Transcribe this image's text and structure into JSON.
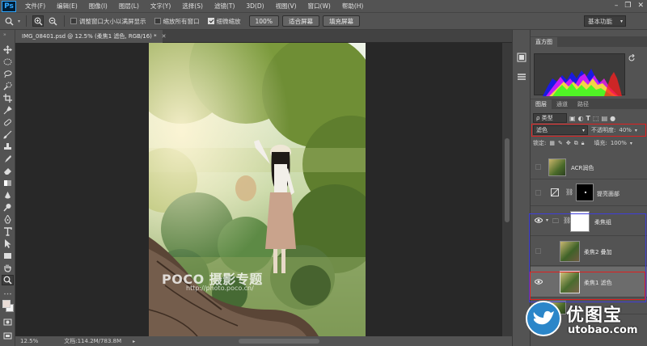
{
  "app": {
    "logo": "Ps"
  },
  "menu": [
    "文件(F)",
    "编辑(E)",
    "图像(I)",
    "图层(L)",
    "文字(Y)",
    "选择(S)",
    "滤镜(T)",
    "3D(D)",
    "视图(V)",
    "窗口(W)",
    "帮助(H)"
  ],
  "options": {
    "check1": "调整窗口大小以满屏显示",
    "check2": "缩放所有窗口",
    "check3": "细微缩放",
    "zoom_btn": "100%",
    "fit_btn": "适合屏幕",
    "fill_btn": "填充屏幕",
    "workspace": "基本功能"
  },
  "document": {
    "tab_title": "IMG_08401.psd @ 12.5% (柔焦1  滤色, RGB/16) *",
    "zoom": "12.5%",
    "doc_size": "文档:114.2M/783.8M",
    "watermark": "POCO 摄影专题",
    "watermark_url": "http://photo.poco.cn/"
  },
  "panels": {
    "histogram_tab": "直方图",
    "tabs": [
      "图层",
      "通道",
      "路径"
    ],
    "kind_filter": "ρ 类型",
    "blend_mode": "滤色",
    "opacity_label": "不透明度:",
    "opacity_value": "40%",
    "lock_label": "锁定:",
    "fill_label": "填充:",
    "fill_value": "100%"
  },
  "layers": [
    {
      "name": "ACR润色",
      "visible": false
    },
    {
      "name": "提亮面部",
      "visible": false
    },
    {
      "name": "柔焦组",
      "visible": true
    },
    {
      "name": "柔焦2  叠加",
      "visible": false
    },
    {
      "name": "柔焦1  滤色",
      "visible": true
    }
  ],
  "brand": {
    "logo_cn": "优图宝",
    "logo_en": "utobao.com"
  },
  "colors": {
    "highlight_red": "#e02020",
    "highlight_blue": "#3f3fd8",
    "ps_blue": "#31a8ff"
  }
}
